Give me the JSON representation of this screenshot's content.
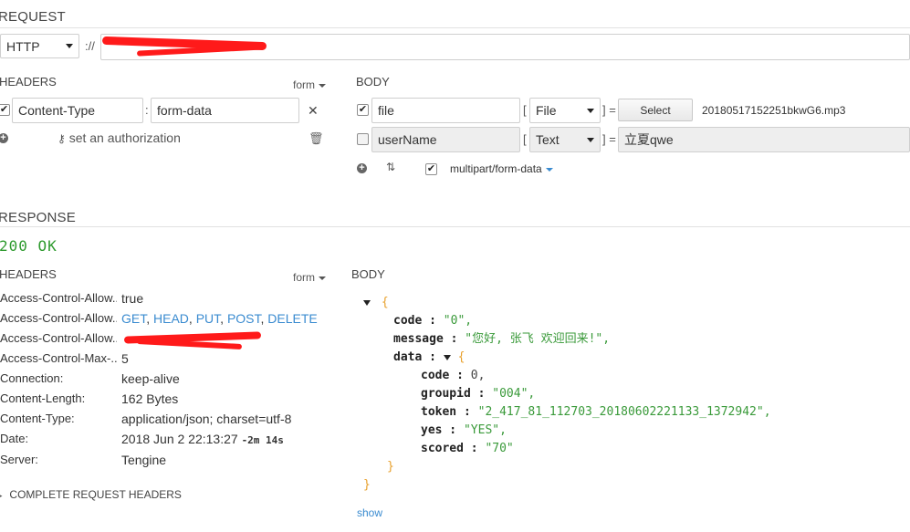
{
  "request": {
    "title": "REQUEST",
    "protocol": "HTTP",
    "scheme_sep": "://",
    "headers": {
      "title": "HEADERS",
      "mode": "form",
      "rows": [
        {
          "name": "Content-Type",
          "sep": ":",
          "value": "form-data",
          "checked": true
        }
      ],
      "auth_label": "set an authorization"
    },
    "body": {
      "title": "BODY",
      "rows": [
        {
          "name": "file",
          "type": "File",
          "eq": "] =",
          "open": "[",
          "button": "Select",
          "filename": "20180517152251bkwG6.mp3",
          "checked": true
        },
        {
          "name": "userName",
          "type": "Text",
          "eq": "] =",
          "open": "[",
          "value": "立夏qwe",
          "checked": false
        }
      ],
      "encoding": "multipart/form-data"
    }
  },
  "response": {
    "title": "RESPONSE",
    "status": "200 OK",
    "headers": {
      "title": "HEADERS",
      "mode": "form",
      "rows": [
        {
          "name": "Access-Control-Allow...",
          "value": "true"
        },
        {
          "name": "Access-Control-Allow...",
          "methods": [
            "GET",
            "HEAD",
            "PUT",
            "POST",
            "DELETE"
          ]
        },
        {
          "name": "Access-Control-Allow...",
          "value": ""
        },
        {
          "name": "Access-Control-Max-...",
          "value": "5"
        },
        {
          "name": "Connection:",
          "value": "keep-alive"
        },
        {
          "name": "Content-Length:",
          "value": "162 Bytes"
        },
        {
          "name": "Content-Type:",
          "value": "application/json; charset=utf-8"
        },
        {
          "name": "Date:",
          "value": "2018 Jun 2 22:13:27",
          "extra": "-2m 14s"
        },
        {
          "name": "Server:",
          "value": "Tengine"
        }
      ],
      "complete_label": "COMPLETE REQUEST HEADERS"
    },
    "body": {
      "title": "BODY",
      "json": {
        "code_key": "code :",
        "code_val": "\"0\",",
        "message_key": "message :",
        "message_val": "\"您好, 张飞 欢迎回来!\",",
        "data_key": "data :",
        "d_code_key": "code :",
        "d_code_val": "0,",
        "d_groupid_key": "groupid :",
        "d_groupid_val": "\"004\",",
        "d_token_key": "token :",
        "d_token_val": "\"2_417_81_112703_20180602221133_1372942\",",
        "d_yes_key": "yes :",
        "d_yes_val": "\"YES\",",
        "d_scored_key": "scored :",
        "d_scored_val": "\"70\""
      },
      "show_label": "show"
    }
  },
  "colors": {
    "status_green": "#2e9a2e",
    "link_blue": "#3a8bd0",
    "json_string": "#3a9a3a",
    "json_brace": "#e8a02c",
    "redaction": "#ff1a1a"
  }
}
